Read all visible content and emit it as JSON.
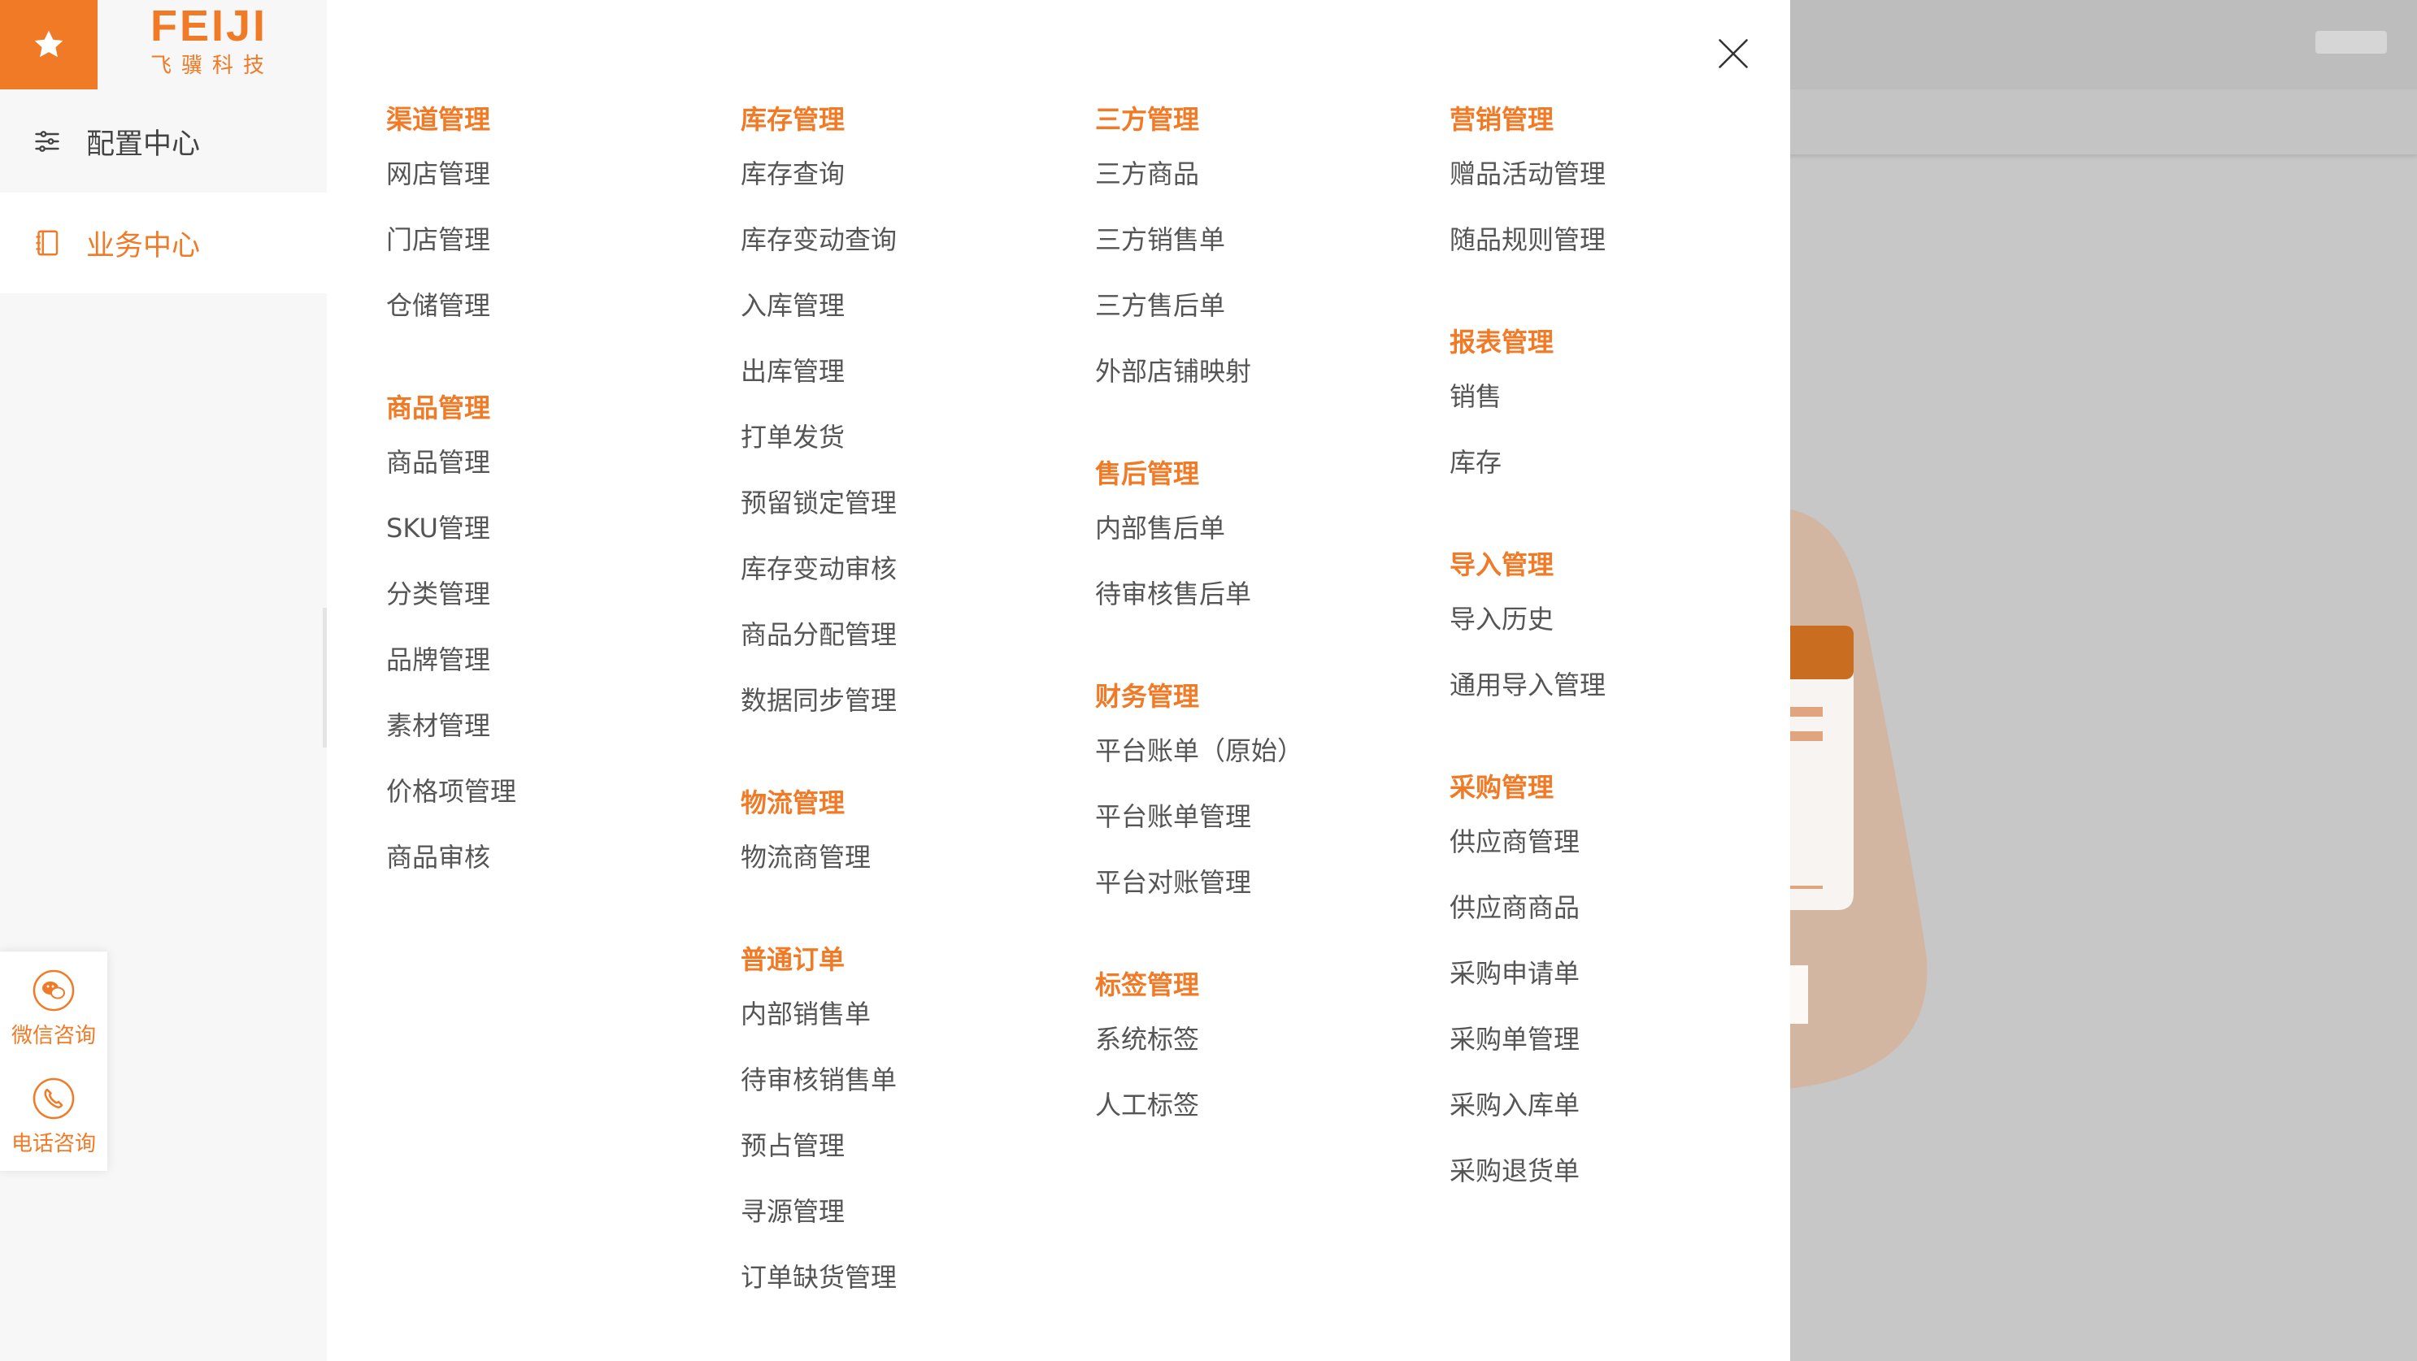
{
  "brand": {
    "name_en": "FEIJI",
    "name_cn": "飞骥科技",
    "accent_color": "#f07a26",
    "logo_icon": "star-icon"
  },
  "sidebar": {
    "items": [
      {
        "label": "配置中心",
        "icon": "sliders-icon",
        "active": false
      },
      {
        "label": "业务中心",
        "icon": "notebook-icon",
        "active": true
      }
    ],
    "consult": [
      {
        "label": "微信咨询",
        "icon": "wechat-icon"
      },
      {
        "label": "电话咨询",
        "icon": "phone-icon"
      }
    ]
  },
  "menu": {
    "close_icon": "close-icon",
    "columns": [
      [
        {
          "title": "渠道管理",
          "items": [
            "网店管理",
            "门店管理",
            "仓储管理"
          ]
        },
        {
          "title": "商品管理",
          "items": [
            "商品管理",
            "SKU管理",
            "分类管理",
            "品牌管理",
            "素材管理",
            "价格项管理",
            "商品审核"
          ]
        }
      ],
      [
        {
          "title": "库存管理",
          "items": [
            "库存查询",
            "库存变动查询",
            "入库管理",
            "出库管理",
            "打单发货",
            "预留锁定管理",
            "库存变动审核",
            "商品分配管理",
            "数据同步管理"
          ]
        },
        {
          "title": "物流管理",
          "items": [
            "物流商管理"
          ]
        },
        {
          "title": "普通订单",
          "items": [
            "内部销售单",
            "待审核销售单",
            "预占管理",
            "寻源管理",
            "订单缺货管理"
          ]
        }
      ],
      [
        {
          "title": "三方管理",
          "items": [
            "三方商品",
            "三方销售单",
            "三方售后单",
            "外部店铺映射"
          ]
        },
        {
          "title": "售后管理",
          "items": [
            "内部售后单",
            "待审核售后单"
          ]
        },
        {
          "title": "财务管理",
          "items": [
            "平台账单（原始）",
            "平台账单管理",
            "平台对账管理"
          ]
        },
        {
          "title": "标签管理",
          "items": [
            "系统标签",
            "人工标签"
          ]
        }
      ],
      [
        {
          "title": "营销管理",
          "items": [
            "赠品活动管理",
            "随品规则管理"
          ]
        },
        {
          "title": "报表管理",
          "items": [
            "销售",
            "库存"
          ]
        },
        {
          "title": "导入管理",
          "items": [
            "导入历史",
            "通用导入管理"
          ]
        },
        {
          "title": "采购管理",
          "items": [
            "供应商管理",
            "供应商商品",
            "采购申请单",
            "采购单管理",
            "采购入库单",
            "采购退货单"
          ]
        }
      ]
    ]
  }
}
